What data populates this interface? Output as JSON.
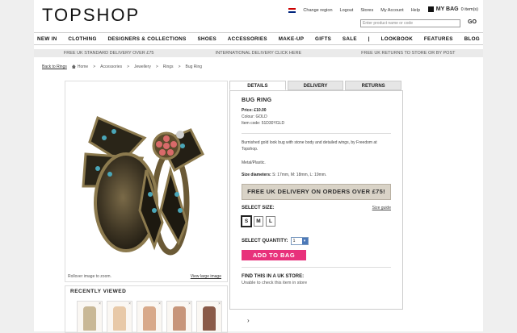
{
  "header": {
    "logo": "TOPSHOP",
    "util_links": [
      "Change region",
      "Logout",
      "Stores",
      "My Account",
      "Help"
    ],
    "bag_label": "MY BAG",
    "bag_items": "0 item(s)",
    "search_placeholder": "Enter product name or code",
    "go_label": "GO"
  },
  "nav": [
    "NEW IN",
    "CLOTHING",
    "DESIGNERS & COLLECTIONS",
    "SHOES",
    "ACCESSORIES",
    "MAKE-UP",
    "GIFTS",
    "SALE",
    "|",
    "LOOKBOOK",
    "FEATURES",
    "BLOG"
  ],
  "promo": [
    "FREE UK STANDARD DELIVERY OVER £75",
    "INTERNATIONAL DELIVERY CLICK HERE",
    "FREE UK RETURNS TO STORE OR BY POST"
  ],
  "breadcrumb": {
    "back": "Back to Rings",
    "items": [
      "Home",
      ">",
      "Accessories",
      ">",
      "Jewellery",
      ">",
      "Rings",
      ">",
      "Bug Ring"
    ]
  },
  "image": {
    "rollover": "Rollover image to zoom.",
    "large": "View large image"
  },
  "recent": {
    "title": "RECENTLY VIEWED",
    "thumb_colors": [
      "#c9b896",
      "#e8c9a8",
      "#d8a98a",
      "#c7957a",
      "#8a5a48"
    ]
  },
  "tabs": [
    "DETAILS",
    "DELIVERY",
    "RETURNS"
  ],
  "product": {
    "name": "BUG RING",
    "price_label": "Price:",
    "price": "£10.00",
    "colour": "Colour: GOLD",
    "item_code": "Item code: 51D30YGLD",
    "description": "Burnished gold look bug with stone body and detailed wings, by Freedom at Topshop.",
    "material": "Metal/Plastic.",
    "size_label": "Size diameters:",
    "size_values": "S: 17mm, M: 18mm, L: 19mm.",
    "banner": "FREE UK DELIVERY ON ORDERS OVER £75!",
    "select_size": "SELECT SIZE:",
    "size_guide": "Size guide",
    "sizes": [
      "S",
      "M",
      "L"
    ],
    "select_quantity": "SELECT QUANTITY:",
    "quantity": "1",
    "add_to_bag": "ADD TO BAG",
    "find_title": "FIND THIS IN A UK STORE:",
    "find_sub": "Unable to check this item in store"
  },
  "colors": {
    "accent": "#e8317b",
    "banner": "#d9d3c7"
  }
}
